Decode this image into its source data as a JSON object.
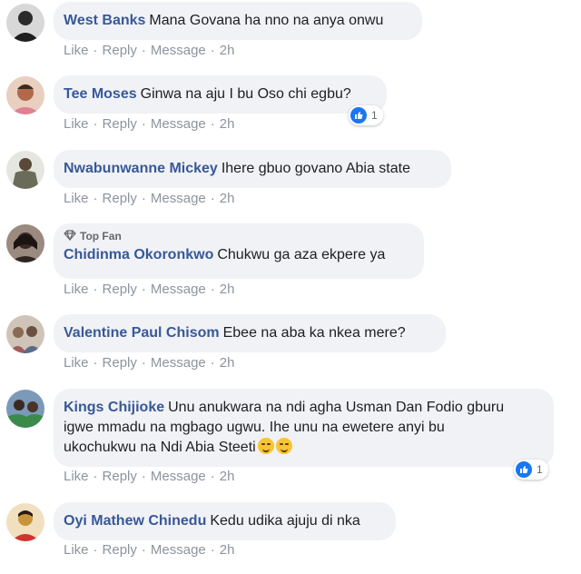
{
  "actions": {
    "like": "Like",
    "reply": "Reply",
    "message": "Message",
    "separator": "·",
    "time": "2h"
  },
  "top_fan_label": "Top Fan",
  "comments": [
    {
      "author": "West Banks",
      "text": "Mana Govana ha nno na anya onwu",
      "avatar_color": "#2b2b2b"
    },
    {
      "author": "Tee Moses",
      "text": "Ginwa na aju I bu Oso chi egbu?",
      "avatar_color": "#c47a5a",
      "reactions": "1"
    },
    {
      "author": "Nwabunwanne Mickey",
      "text": "Ihere gbuo govano Abia state",
      "avatar_color": "#6b6b5a"
    },
    {
      "author": "Chidinma Okoronkwo",
      "text": "Chukwu ga aza ekpere ya",
      "avatar_color": "#4a3b35",
      "top_fan": true
    },
    {
      "author": "Valentine Paul Chisom",
      "text": "Ebee na aba ka nkea mere?",
      "avatar_color": "#8a7a70"
    },
    {
      "author": "Kings Chijioke",
      "text_lines": [
        "Unu anukwara na ndi agha Usman Dan Fodio gburu",
        "igwe mmadu na mgbago ugwu. Ihe unu na ewetere anyi bu",
        "ukochukwu na Ndi Abia Steeti"
      ],
      "avatar_color": "#5b7a9a",
      "reactions": "1",
      "emoji_count": 2
    },
    {
      "author": "Oyi Mathew Chinedu",
      "text": "Kedu udika ajuju di nka",
      "avatar_color": "#c8943a"
    }
  ],
  "colors": {
    "author": "#385898",
    "bubble": "#f0f2f5",
    "meta": "#8d949e",
    "like_blue": "#1877f2"
  }
}
